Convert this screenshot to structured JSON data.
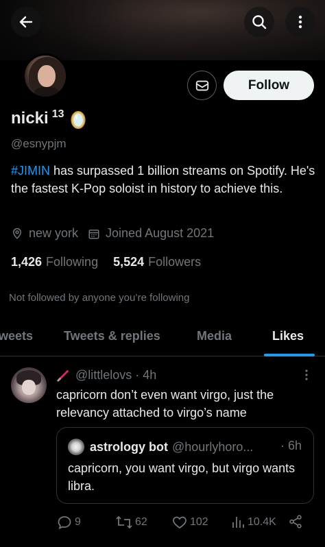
{
  "header": {
    "back_icon": "arrow-left-icon",
    "search_icon": "search-icon",
    "more_icon": "more-vertical-icon"
  },
  "profile": {
    "name": "nicki",
    "name_suffix": "13",
    "name_emoji": "mirror-emoji",
    "handle": "@esnypjm",
    "bio_hashtag": "#JIMIN",
    "bio_rest": " has surpassed 1 billion streams on Spotify. He's the fastest K-Pop soloist in history to achieve this.",
    "location": "new york",
    "joined": "Joined August 2021",
    "following_count": "1,426",
    "following_label": "Following",
    "followers_count": "5,524",
    "followers_label": "Followers",
    "not_followed_text": "Not followed by anyone you’re following",
    "follow_label": "Follow"
  },
  "tabs": [
    {
      "label": "Tweets",
      "shown": "weets"
    },
    {
      "label": "Tweets & replies"
    },
    {
      "label": "Media"
    },
    {
      "label": "Likes",
      "active": true
    }
  ],
  "tweet": {
    "handle": "@littlelovs",
    "sep": "·",
    "time": "4h",
    "text": "capricorn don’t even want virgo, just the relevancy attached to virgo’s name",
    "quote": {
      "name": "astrology bot",
      "handle": "@hourlyhoro...",
      "time": "· 6h",
      "text": "capricorn, you want virgo, but virgo wants libra."
    },
    "actions": {
      "replies": "9",
      "retweets": "62",
      "likes": "102",
      "views": "10.4K"
    }
  },
  "colors": {
    "accent": "#1d9bf0",
    "muted": "#71767b",
    "text": "#e7e9ea",
    "background": "#000000"
  }
}
